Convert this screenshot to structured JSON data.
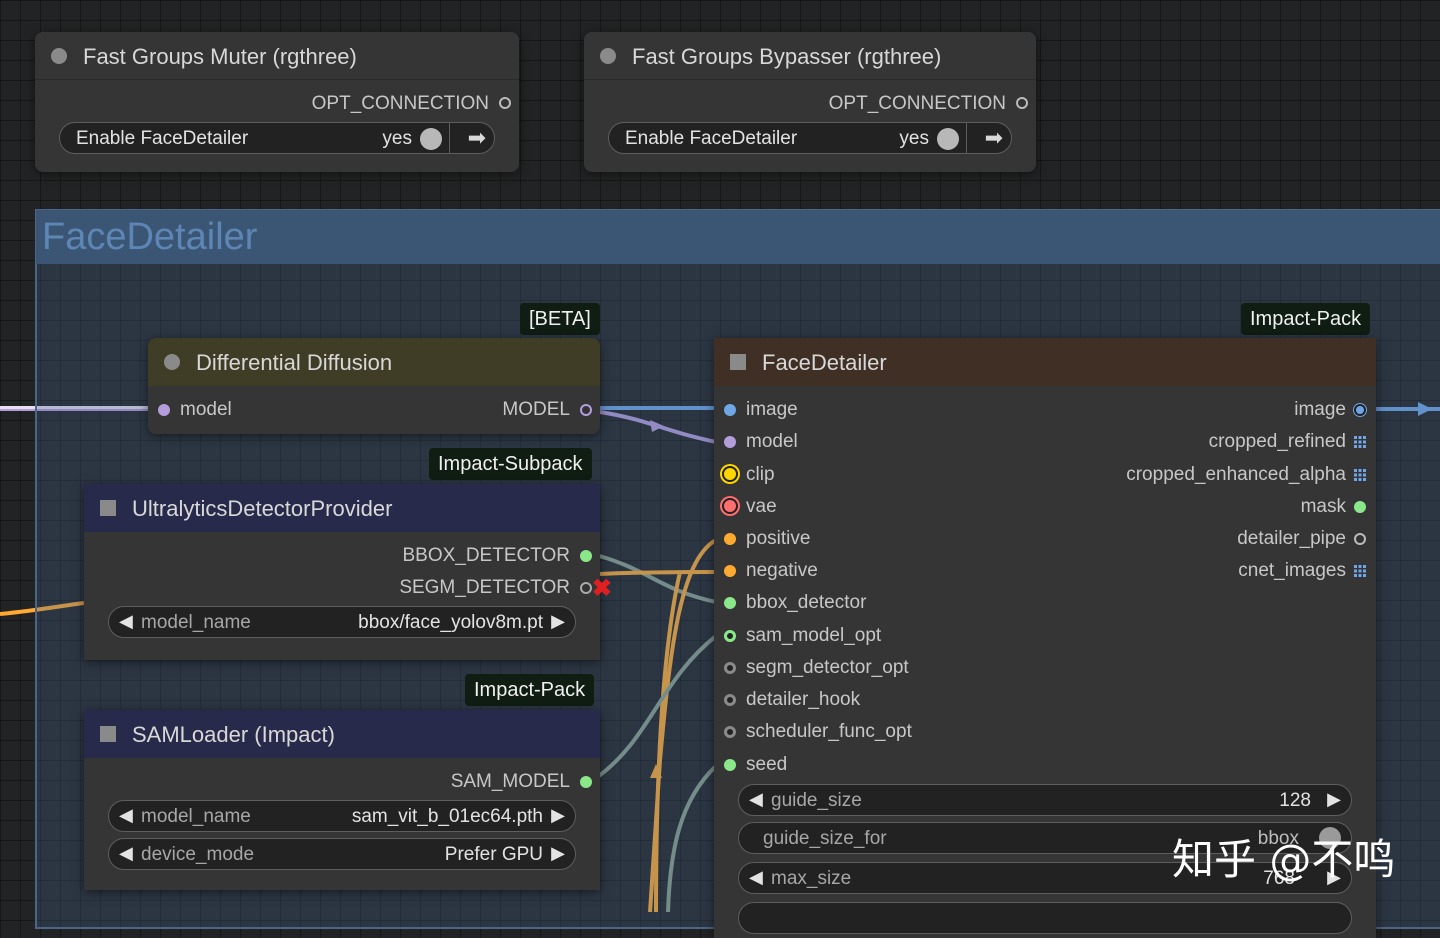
{
  "muter": {
    "title": "Fast Groups Muter (rgthree)",
    "output": "OPT_CONNECTION",
    "toggle_label": "Enable FaceDetailer",
    "toggle_value": "yes"
  },
  "bypasser": {
    "title": "Fast Groups Bypasser (rgthree)",
    "output": "OPT_CONNECTION",
    "toggle_label": "Enable FaceDetailer",
    "toggle_value": "yes"
  },
  "group": {
    "title": "FaceDetailer"
  },
  "diff": {
    "badge": "[BETA]",
    "title": "Differential Diffusion",
    "input": "model",
    "output": "MODEL"
  },
  "ultra": {
    "badge": "Impact-Subpack",
    "title": "UltralyticsDetectorProvider",
    "outputs": [
      "BBOX_DETECTOR",
      "SEGM_DETECTOR"
    ],
    "widget": {
      "name": "model_name",
      "value": "bbox/face_yolov8m.pt"
    }
  },
  "sam": {
    "badge": "Impact-Pack",
    "title": "SAMLoader (Impact)",
    "output": "SAM_MODEL",
    "widgets": [
      {
        "name": "model_name",
        "value": "sam_vit_b_01ec64.pth"
      },
      {
        "name": "device_mode",
        "value": "Prefer GPU"
      }
    ]
  },
  "fd": {
    "badge": "Impact-Pack",
    "title": "FaceDetailer",
    "inputs": [
      "image",
      "model",
      "clip",
      "vae",
      "positive",
      "negative",
      "bbox_detector",
      "sam_model_opt",
      "segm_detector_opt",
      "detailer_hook",
      "scheduler_func_opt",
      "seed"
    ],
    "outputs": [
      "image",
      "cropped_refined",
      "cropped_enhanced_alpha",
      "mask",
      "detailer_pipe",
      "cnet_images"
    ],
    "widgets": [
      {
        "name": "guide_size",
        "value": "128"
      },
      {
        "name": "guide_size_for",
        "value": "bbox"
      },
      {
        "name": "max_size",
        "value": "768"
      }
    ]
  },
  "watermark": "知乎 @不鸣",
  "colors": {
    "image": "#6fa6e8",
    "model": "#b39ddb",
    "clip": "#ffd500",
    "vae": "#ff6e6e",
    "conditioning": "#ffa931",
    "detector": "#8ae88a"
  }
}
